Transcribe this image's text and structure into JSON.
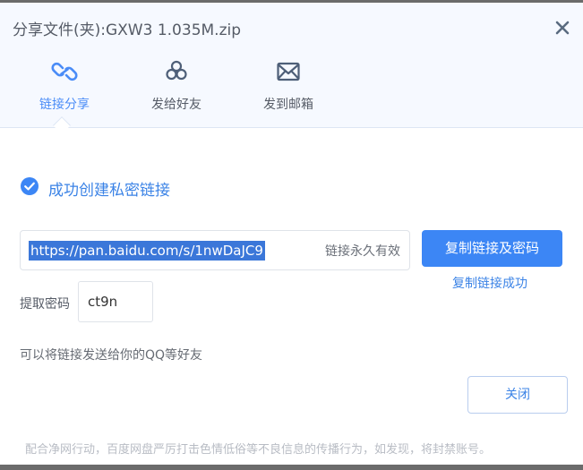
{
  "dialog": {
    "title": "分享文件(夹):GXW3 1.035M.zip"
  },
  "tabs": [
    {
      "label": "链接分享",
      "icon": "link-icon",
      "active": true
    },
    {
      "label": "发给好友",
      "icon": "friends-icon",
      "active": false
    },
    {
      "label": "发到邮箱",
      "icon": "mail-icon",
      "active": false
    }
  ],
  "result": {
    "success_text": "成功创建私密链接",
    "url": "https://pan.baidu.com/s/1nwDaJC9",
    "validity": "链接永久有效",
    "copy_button": "复制链接及密码",
    "copy_status": "复制链接成功",
    "code_label": "提取密码",
    "code_value": "ct9n",
    "hint": "可以将链接发送给你的QQ等好友"
  },
  "footer": {
    "close_button": "关闭",
    "notice": "配合净网行动，百度网盘严厉打击色情低俗等不良信息的传播行为，如发现，将封禁账号。"
  },
  "colors": {
    "accent": "#3c86f5",
    "header_bg": "#f6f9ff",
    "text": "#555b66"
  }
}
